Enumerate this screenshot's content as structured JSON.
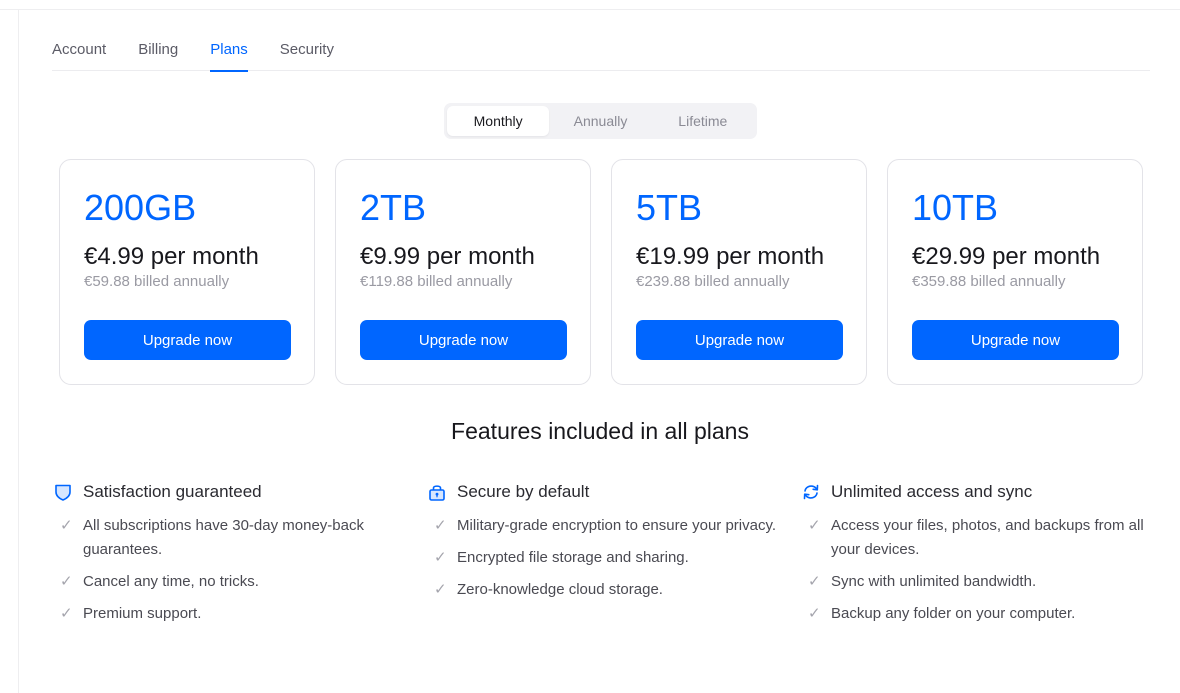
{
  "tabs": [
    {
      "label": "Account",
      "active": false
    },
    {
      "label": "Billing",
      "active": false
    },
    {
      "label": "Plans",
      "active": true
    },
    {
      "label": "Security",
      "active": false
    }
  ],
  "billing_period": {
    "options": [
      "Monthly",
      "Annually",
      "Lifetime"
    ],
    "selected": "Monthly"
  },
  "plans": [
    {
      "size": "200GB",
      "price": "€4.99 per month",
      "billed": "€59.88 billed annually",
      "button": "Upgrade now"
    },
    {
      "size": "2TB",
      "price": "€9.99 per month",
      "billed": "€119.88 billed annually",
      "button": "Upgrade now"
    },
    {
      "size": "5TB",
      "price": "€19.99 per month",
      "billed": "€239.88 billed annually",
      "button": "Upgrade now"
    },
    {
      "size": "10TB",
      "price": "€29.99 per month",
      "billed": "€359.88 billed annually",
      "button": "Upgrade now"
    }
  ],
  "features": {
    "title": "Features included in all plans",
    "columns": [
      {
        "icon": "shield-icon",
        "title": "Satisfaction guaranteed",
        "items": [
          "All subscriptions have 30-day money-back guarantees.",
          "Cancel any time, no tricks.",
          "Premium support."
        ]
      },
      {
        "icon": "lock-icon",
        "title": "Secure by default",
        "items": [
          "Military-grade encryption to ensure your privacy.",
          "Encrypted file storage and sharing.",
          "Zero-knowledge cloud storage."
        ]
      },
      {
        "icon": "sync-icon",
        "title": "Unlimited access and sync",
        "items": [
          "Access your files, photos, and backups from all your devices.",
          "Sync with unlimited bandwidth.",
          "Backup any folder on your computer."
        ]
      }
    ]
  },
  "colors": {
    "accent": "#0066ff",
    "muted": "#9a9aa3",
    "border": "#e3e3e8"
  }
}
